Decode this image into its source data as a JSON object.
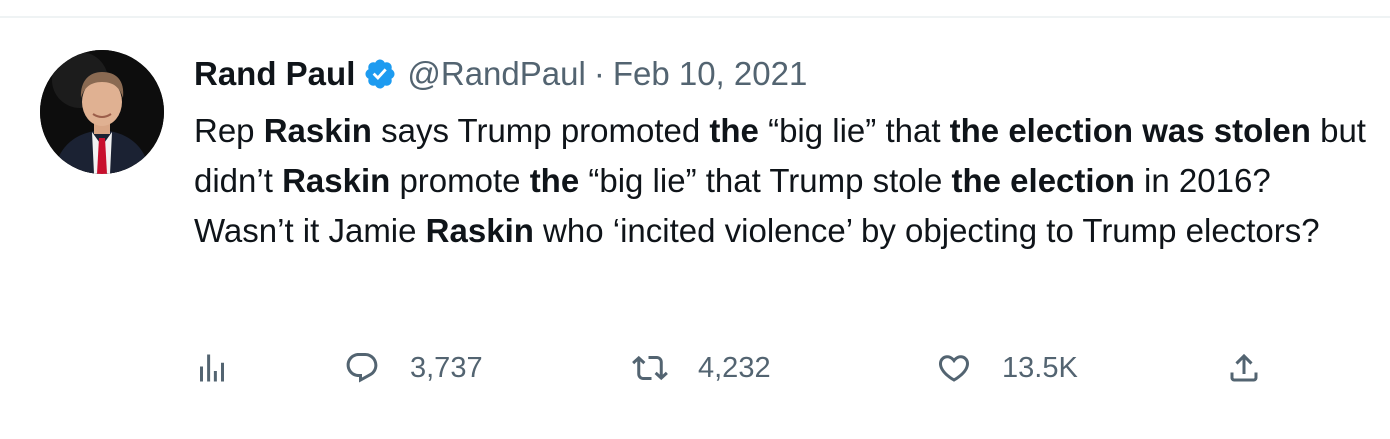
{
  "tweet": {
    "author_name": "Rand Paul",
    "handle": "@RandPaul",
    "separator": "·",
    "date": "Feb 10, 2021",
    "verified": true,
    "text_segments": [
      {
        "text": "Rep ",
        "bold": false
      },
      {
        "text": "Raskin",
        "bold": true
      },
      {
        "text": " says Trump promoted ",
        "bold": false
      },
      {
        "text": "the",
        "bold": true
      },
      {
        "text": " “big lie” that ",
        "bold": false
      },
      {
        "text": "the election was stolen",
        "bold": true
      },
      {
        "text": " but didn’t ",
        "bold": false
      },
      {
        "text": "Raskin",
        "bold": true
      },
      {
        "text": " promote ",
        "bold": false
      },
      {
        "text": "the",
        "bold": true
      },
      {
        "text": " “big lie” that Trump stole ",
        "bold": false
      },
      {
        "text": "the election",
        "bold": true
      },
      {
        "text": " in 2016? Wasn’t it Jamie ",
        "bold": false
      },
      {
        "text": "Raskin",
        "bold": true
      },
      {
        "text": " who ‘incited violence’ by objecting to Trump electors?",
        "bold": false
      }
    ]
  },
  "actions": {
    "views_icon": "bar-chart-icon",
    "reply_icon": "speech-bubble-icon",
    "reply_count": "3,737",
    "retweet_icon": "retweet-icon",
    "retweet_count": "4,232",
    "like_icon": "heart-icon",
    "like_count": "13.5K",
    "share_icon": "share-icon"
  },
  "colors": {
    "text_primary": "#0f1419",
    "text_secondary": "#536471",
    "verified_blue": "#1d9bf0",
    "divider": "#eff3f4"
  }
}
